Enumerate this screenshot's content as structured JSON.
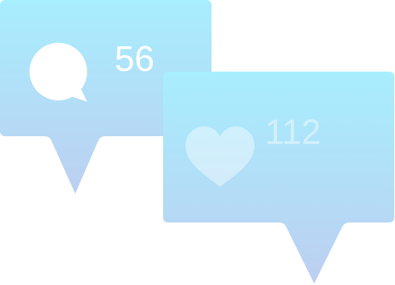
{
  "notifications": {
    "comments": {
      "icon": "comment-icon",
      "count": "56"
    },
    "likes": {
      "icon": "heart-icon",
      "count": "112"
    }
  },
  "colors": {
    "bubble_top": "#a7eefe",
    "bubble_bottom": "#bdd0f1",
    "icon_comment": "#ffffff",
    "icon_heart": "#ffffff"
  }
}
